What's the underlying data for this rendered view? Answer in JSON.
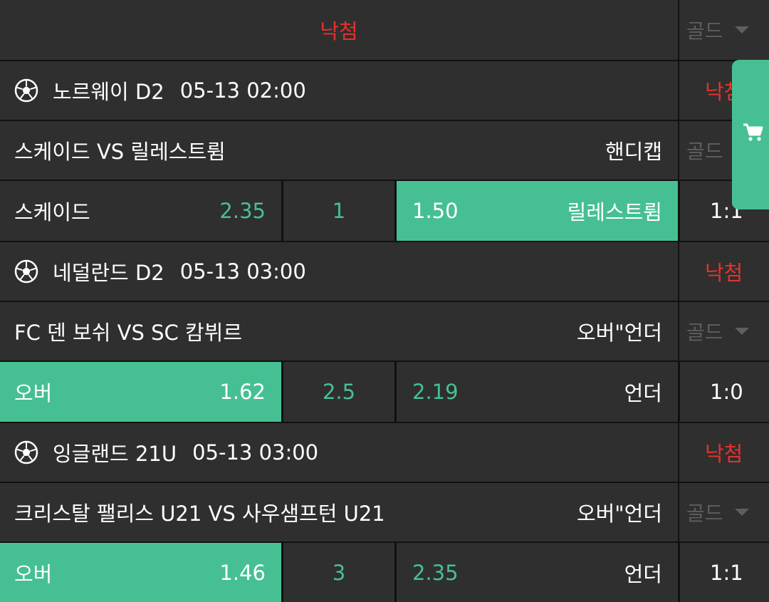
{
  "header": {
    "title": "낙첨",
    "gold": "골드"
  },
  "matches": [
    {
      "league": "노르웨이 D2",
      "time": "05-13 02:00",
      "result": "낙첨",
      "teams": "스케이드 VS 릴레스트륌",
      "bet_type": "핸디캡",
      "gold": "골드",
      "home_label": "스케이드",
      "home_odds": "2.35",
      "line": "1",
      "away_odds": "1.50",
      "away_label": "릴레스트륌",
      "score": "1:1"
    },
    {
      "league": "네덜란드 D2",
      "time": "05-13 03:00",
      "result": "낙첨",
      "teams": "FC 덴 보쉬 VS SC 캄뷔르",
      "bet_type": "오버\"언더",
      "gold": "골드",
      "home_label": "오버",
      "home_odds": "1.62",
      "line": "2.5",
      "away_odds": "2.19",
      "away_label": "언더",
      "score": "1:0"
    },
    {
      "league": "잉글랜드 21U",
      "time": "05-13 03:00",
      "result": "낙첨",
      "teams": "크리스탈 팰리스 U21 VS 사우샘프턴 U21",
      "bet_type": "오버\"언더",
      "gold": "골드",
      "home_label": "오버",
      "home_odds": "1.46",
      "line": "3",
      "away_odds": "2.35",
      "away_label": "언더",
      "score": "1:1"
    }
  ],
  "colors": {
    "accent": "#46c092",
    "loss": "#e2332b",
    "cell": "#2f2f2f",
    "divider": "#111111"
  },
  "icons": {
    "sport": "soccer-ball-icon",
    "cart": "cart-icon",
    "dropdown": "caret-down-icon"
  }
}
